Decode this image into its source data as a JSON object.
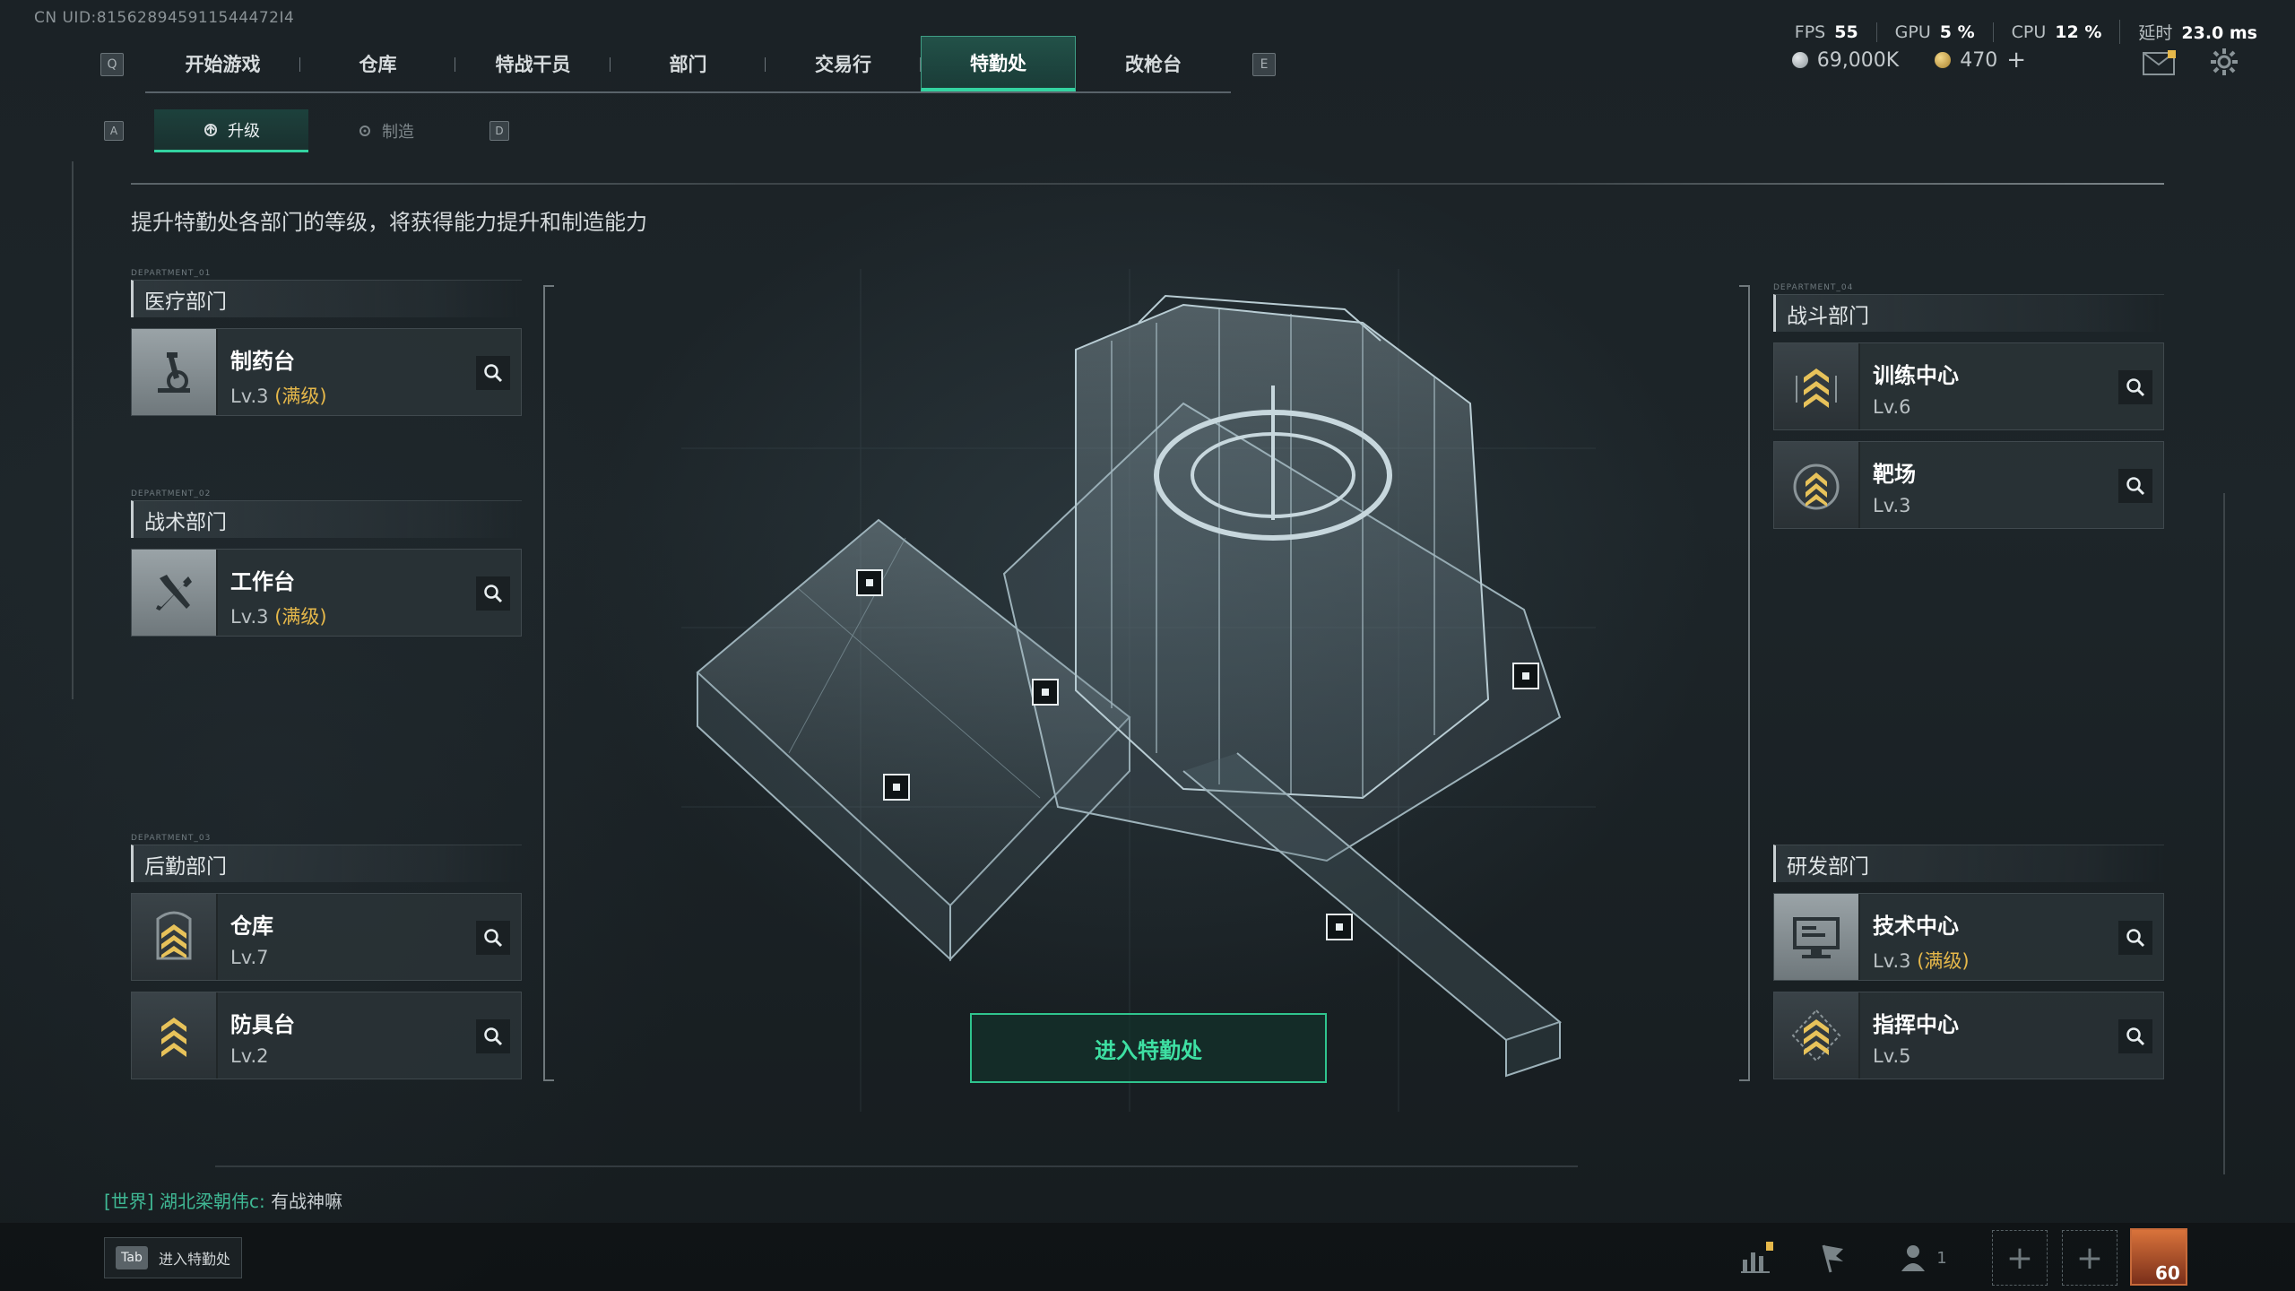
{
  "uid": "CN UID:815628945911544472I4",
  "perf": {
    "fps_label": "FPS",
    "fps_value": "55",
    "gpu_label": "GPU",
    "gpu_value": "5 %",
    "cpu_label": "CPU",
    "cpu_value": "12 %",
    "latency_label": "延时",
    "latency_value": "23.0 ms"
  },
  "nav": {
    "left_key": "Q",
    "right_key": "E",
    "tabs": [
      "开始游戏",
      "仓库",
      "特战干员",
      "部门",
      "交易行",
      "特勤处",
      "改枪台"
    ],
    "active_index": 5
  },
  "currency": {
    "coins": "69,000K",
    "tickets": "470",
    "add": "+"
  },
  "subnav": {
    "left_key": "A",
    "right_key": "D",
    "tabs": [
      "升级",
      "制造"
    ],
    "active_index": 0
  },
  "subtitle": "提升特勤处各部门的等级，将获得能力提升和制造能力",
  "departments": {
    "medical": {
      "tag": "DEPARTMENT_01",
      "title": "医疗部门",
      "facilities": [
        {
          "name": "制药台",
          "level": "Lv.3",
          "max": "(满级)",
          "icon": "microscope-icon"
        }
      ]
    },
    "tactical": {
      "tag": "DEPARTMENT_02",
      "title": "战术部门",
      "facilities": [
        {
          "name": "工作台",
          "level": "Lv.3",
          "max": "(满级)",
          "icon": "hammer-wrench-icon"
        }
      ]
    },
    "logistics": {
      "tag": "DEPARTMENT_03",
      "title": "后勤部门",
      "facilities": [
        {
          "name": "仓库",
          "level": "Lv.7",
          "icon": "rank-chevron-icon"
        },
        {
          "name": "防具台",
          "level": "Lv.2",
          "icon": "rank-chevron-icon"
        }
      ]
    },
    "combat": {
      "tag": "DEPARTMENT_04",
      "title": "战斗部门",
      "facilities": [
        {
          "name": "训练中心",
          "level": "Lv.6",
          "icon": "rank-chevron-icon"
        },
        {
          "name": "靶场",
          "level": "Lv.3",
          "icon": "rank-chevron-icon"
        }
      ]
    },
    "research": {
      "title": "研发部门",
      "facilities": [
        {
          "name": "技术中心",
          "level": "Lv.3",
          "max": "(满级)",
          "icon": "monitor-icon"
        },
        {
          "name": "指挥中心",
          "level": "Lv.5",
          "icon": "rank-chevron-icon"
        }
      ]
    }
  },
  "enter_button": "进入特勤处",
  "chat": {
    "channel": "[世界]",
    "sender": "湖北梁朝伟c:",
    "message": "有战神嘛"
  },
  "bottom": {
    "tab_key": "Tab",
    "tab_label": "进入特勤处",
    "squad_count": "1",
    "avatar_level": "60"
  },
  "colors": {
    "accent": "#33d3a1",
    "max_level": "#e6b84a",
    "rank_gold": "#e7c25a"
  }
}
